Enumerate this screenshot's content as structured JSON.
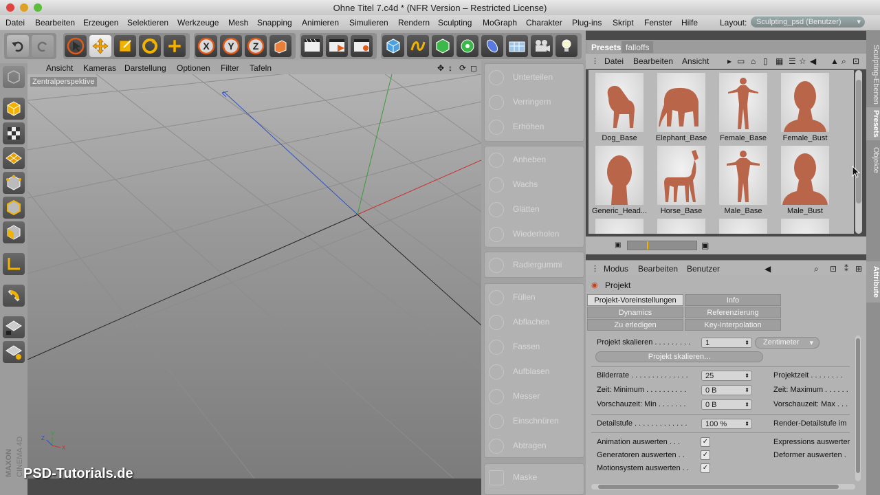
{
  "window": {
    "title": "Ohne Titel 7.c4d * (NFR Version – Restricted License)"
  },
  "menubar": {
    "items": [
      "Datei",
      "Bearbeiten",
      "Erzeugen",
      "Selektieren",
      "Werkzeuge",
      "Mesh",
      "Snapping",
      "Animieren",
      "Simulieren",
      "Rendern",
      "Sculpting",
      "MoGraph",
      "Charakter",
      "Plug-ins",
      "Skript",
      "Fenster",
      "Hilfe"
    ],
    "layout_label": "Layout:",
    "layout_value": "Sculpting_psd (Benutzer)"
  },
  "toolbar": {
    "icons": [
      "undo-icon",
      "redo-icon",
      "select-icon",
      "move-icon",
      "scale-icon",
      "rotate-icon",
      "add-icon",
      "x-axis-icon",
      "y-axis-icon",
      "z-axis-icon",
      "coordinate-system-icon",
      "render-view-icon",
      "render-picture-viewer-icon",
      "render-settings-icon",
      "cube-icon",
      "spline-icon",
      "generator-icon",
      "array-icon",
      "deformer-icon",
      "scene-icon",
      "camera-icon",
      "light-icon"
    ],
    "axis_labels": [
      "X",
      "Y",
      "Z"
    ]
  },
  "viewport": {
    "menu": [
      "Ansicht",
      "Kameras",
      "Darstellung",
      "Optionen",
      "Filter",
      "Tafeln"
    ],
    "label": "Zentralperspektive",
    "watermark": "PSD-Tutorials.de",
    "brand": "MAXON CINEMA 4D"
  },
  "sculpt": {
    "groups": [
      [
        "Unterteilen",
        "Verringern",
        "Erhöhen"
      ],
      [
        "Anheben",
        "Wachs",
        "Glätten",
        "Wiederholen"
      ],
      [
        "Radiergummi"
      ],
      [
        "Füllen",
        "Abflachen",
        "Fassen",
        "Aufblasen",
        "Messer",
        "Einschnüren",
        "Abtragen"
      ],
      [
        "Maske"
      ]
    ]
  },
  "presets": {
    "tabs": [
      "Presets",
      "falloffs"
    ],
    "menu": [
      "Datei",
      "Bearbeiten",
      "Ansicht"
    ],
    "items": [
      "Dog_Base",
      "Elephant_Base",
      "Female_Base",
      "Female_Bust",
      "Generic_Head...",
      "Horse_Base",
      "Male_Base",
      "Male_Bust"
    ]
  },
  "attributes": {
    "menu": [
      "Modus",
      "Bearbeiten",
      "Benutzer"
    ],
    "object": "Projekt",
    "tabs": [
      "Projekt-Voreinstellungen",
      "Info",
      "Dynamics",
      "Referenzierung",
      "Zu erledigen",
      "Key-Interpolation"
    ],
    "rows": {
      "skalieren_label": "Projekt skalieren . . . . . . . . .",
      "skalieren_value": "1",
      "skalieren_unit": "Zentimeter",
      "skalieren_button": "Projekt skalieren...",
      "bilderrate_label": "Bilderrate . . . . . . . . . . . . . .",
      "bilderrate_value": "25",
      "projektzeit_label": "Projektzeit . . . . . . . .",
      "zeitmin_label": "Zeit: Minimum . . . . . . . . . .",
      "zeitmin_value": "0 B",
      "zeitmax_label": "Zeit: Maximum . . . . . .",
      "vorschau_label": "Vorschauzeit: Min . . . . . . .",
      "vorschau_value": "0 B",
      "vorschaumax_label": "Vorschauzeit: Max . . .",
      "detail_label": "Detailstufe . . . . . . . . . . . . .",
      "detail_value": "100 %",
      "renderdetail_label": "Render-Detailstufe im",
      "anim_label": "Animation auswerten . . .",
      "expr_label": "Expressions auswerter",
      "gen_label": "Generatoren auswerten . .",
      "deformer_label": "Deformer auswerten .",
      "motion_label": "Motionsystem auswerten . ."
    }
  },
  "side_tabs": [
    "Sculpting-Ebenen",
    "Presets",
    "Objekte",
    "Attribute"
  ],
  "colors": {
    "accent_blue": "#2f5fb8",
    "axis_x": "#c83232",
    "axis_y": "#3c9a3c",
    "axis_z": "#3050c0",
    "clay": "#b8654a"
  }
}
